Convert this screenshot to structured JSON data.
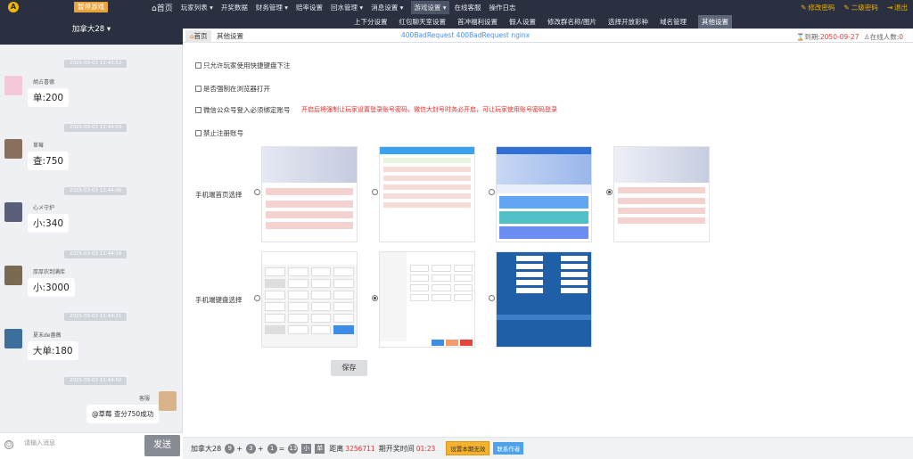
{
  "topbar": {
    "pause_label": "暂停游戏",
    "nav": [
      "玩家列表 ▾",
      "开奖数据",
      "财务管理 ▾",
      "赔率设置",
      "回水管理 ▾",
      "消息设置 ▾",
      "游戏设置 ▾",
      "在线客服",
      "操作日志"
    ],
    "home": "首页",
    "right": [
      "修改密码",
      "二级密码",
      "退出"
    ]
  },
  "subnav": [
    "上下分设置",
    "红包聊天室设置",
    "首冲福利设置",
    "假人设置",
    "修改群名称/图片",
    "选择开放彩种",
    "域名管理",
    "其他设置"
  ],
  "left": {
    "header": "加拿大28 ▾",
    "messages": [
      {
        "time": "2025-03-03 12:43:52",
        "nick": "胡占喜德",
        "text": "单:200"
      },
      {
        "time": "2025-03-03 12:44:03",
        "nick": "草莓",
        "text": "查:750"
      },
      {
        "time": "2025-03-03 12:44:06",
        "nick": "心メ守护",
        "text": "小:340"
      },
      {
        "time": "2025-03-03 12:44:10",
        "nick": "厚厚农到满库",
        "text": "小:3000"
      },
      {
        "time": "2025-03-03 12:44:21",
        "nick": "夏末de蔷薇",
        "text": "大单:180"
      },
      {
        "time": "2025-03-03 12:44:50",
        "nick": "客服",
        "text": "@草莓 查分750成功"
      }
    ],
    "input_placeholder": "请输入消息",
    "send": "发送"
  },
  "tabs": [
    "首页",
    "其他设置"
  ],
  "notice": "400BadRequest 400BadRequest nginx",
  "expire_label": "到期:",
  "expire_date": "2050-09-27",
  "online_label": "在线人数:",
  "online_count": "0",
  "options": [
    "只允许玩家使用快捷键盘下注",
    "是否强制在浏览器打开",
    "微信公众号登入必须绑定账号",
    "禁止注册账号"
  ],
  "warning": "开启后将强制让玩家设置登录账号密码，微信大封号时务必开启，可让玩家使用账号密码登录",
  "homepage_label": "手机端首页选择",
  "keyboard_label": "手机端键盘选择",
  "save": "保存",
  "bottom": {
    "game": "加拿大28",
    "b1": "9",
    "b2": "3",
    "b3": "1",
    "sum": "13",
    "tag1": "小",
    "tag2": "单",
    "distance": "距离",
    "issue": "3256711",
    "period_label": "期开奖时间",
    "countdown": "01:23",
    "btn1": "设置本期无效",
    "btn2": "联系作者"
  },
  "colors": {
    "dark": "#2a3040",
    "accent": "#f2b100",
    "danger": "#e0302b",
    "link": "#4790ea"
  }
}
